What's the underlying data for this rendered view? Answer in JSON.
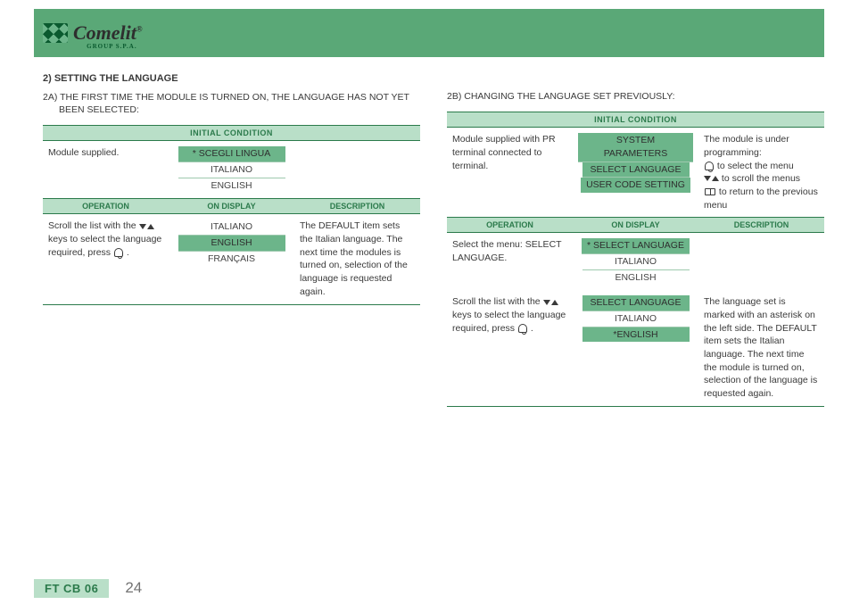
{
  "logo": {
    "brand": "Comelit",
    "reg": "®",
    "subline": "GROUP S.P.A."
  },
  "left": {
    "heading": "2) SETTING THE LANGUAGE",
    "sub": "2A) THE FIRST TIME THE MODULE IS TURNED ON, THE LANGUAGE HAS NOT YET BEEN SELECTED:",
    "initialHeader": "INITIAL CONDITION",
    "row1_op": "Module supplied.",
    "row1_disp": [
      "* SCEGLI LINGUA",
      "ITALIANO",
      "ENGLISH"
    ],
    "row1_hl": [
      true,
      false,
      false
    ],
    "cols": {
      "op": "OPERATION",
      "disp": "ON DISPLAY",
      "desc": "DESCRIPTION"
    },
    "row2_op_pre": "Scroll the list with the ",
    "row2_op_mid": " keys  to select the language required, press ",
    "row2_op_end": " .",
    "row2_disp": [
      "ITALIANO",
      "ENGLISH",
      "FRANÇAIS"
    ],
    "row2_hl": [
      false,
      true,
      false
    ],
    "row2_desc": "The DEFAULT item sets the Italian language. The next time the modules is turned on, selection of the language is requested again."
  },
  "right": {
    "sub": "2B) CHANGING THE LANGUAGE SET PREVIOUSLY:",
    "initialHeader": "INITIAL CONDITION",
    "row1_op": "Module supplied with PR terminal connected to terminal.",
    "row1_disp": [
      "SYSTEM PARAMETERS",
      "SELECT LANGUAGE",
      "USER CODE SETTING"
    ],
    "row1_hl": [
      true,
      true,
      true
    ],
    "row1_desc_intro": "The module is under programming:",
    "row1_desc_bell": " to select the menu",
    "row1_desc_arrows": " to scroll the menus",
    "row1_desc_book": " to return to the previous menu",
    "cols": {
      "op": "OPERATION",
      "disp": "ON DISPLAY",
      "desc": "DESCRIPTION"
    },
    "row2_op": "Select the menu: SELECT LANGUAGE.",
    "row2_disp": [
      "* SELECT LANGUAGE",
      "ITALIANO",
      "ENGLISH"
    ],
    "row2_hl": [
      true,
      false,
      false
    ],
    "row3_op_pre": "Scroll the list with the  ",
    "row3_op_mid": " keys to select the language required, press ",
    "row3_op_end": " .",
    "row3_disp": [
      "SELECT LANGUAGE",
      "ITALIANO",
      "*ENGLISH"
    ],
    "row3_hl": [
      true,
      false,
      true
    ],
    "row3_desc": "The language set is marked with an asterisk on the left side. The DEFAULT item sets the Italian language. The next time the module is turned on, selection of the language is requested again."
  },
  "footer": {
    "code": "FT CB 06",
    "page": "24"
  }
}
